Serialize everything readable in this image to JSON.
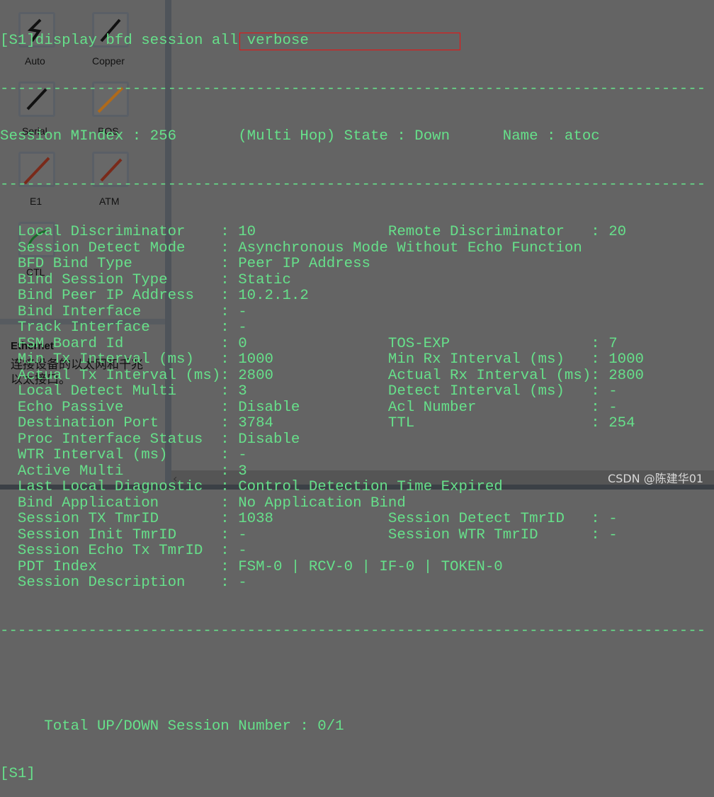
{
  "background_panel": {
    "tiles": [
      {
        "label": "Auto",
        "icon": "lightning-icon"
      },
      {
        "label": "Copper",
        "icon": "copper-cable-icon"
      },
      {
        "label": "Serial",
        "icon": "serial-cable-icon"
      },
      {
        "label": "POS",
        "icon": "pos-cable-icon"
      },
      {
        "label": "E1",
        "icon": "e1-cable-icon"
      },
      {
        "label": "ATM",
        "icon": "atm-cable-icon"
      },
      {
        "label": "CTL",
        "icon": "ctl-cable-icon"
      }
    ],
    "tooltip_title": "Ethernet",
    "tooltip_text": "连接设备的以太网和千兆以太接口。"
  },
  "terminal": {
    "command": "[S1]display bfd session all verbose",
    "separator": "--------------------------------------------------------------------------------",
    "mindex_label": "Session MIndex : 256",
    "state": "(Multi Hop) State : Down",
    "name": "Name : atoc",
    "rows": [
      {
        "l": "Local Discriminator",
        "lv": "10",
        "r": "Remote Discriminator",
        "rv": "20"
      },
      {
        "l": "Session Detect Mode",
        "lv": "Asynchronous Mode Without Echo Function"
      },
      {
        "l": "BFD Bind Type",
        "lv": "Peer IP Address"
      },
      {
        "l": "Bind Session Type",
        "lv": "Static"
      },
      {
        "l": "Bind Peer IP Address",
        "lv": "10.2.1.2"
      },
      {
        "l": "Bind Interface",
        "lv": "-"
      },
      {
        "l": "Track Interface",
        "lv": "-"
      },
      {
        "l": "FSM Board Id",
        "lv": "0",
        "r": "TOS-EXP",
        "rv": "7"
      },
      {
        "l": "Min Tx Interval (ms)",
        "lv": "1000",
        "r": "Min Rx Interval (ms)",
        "rv": "1000"
      },
      {
        "l": "Actual Tx Interval (ms)",
        "lv": "2800",
        "r": "Actual Rx Interval (ms)",
        "rv": "2800"
      },
      {
        "l": "Local Detect Multi",
        "lv": "3",
        "r": "Detect Interval (ms)",
        "rv": "-"
      },
      {
        "l": "Echo Passive",
        "lv": "Disable",
        "r": "Acl Number",
        "rv": "-"
      },
      {
        "l": "Destination Port",
        "lv": "3784",
        "r": "TTL",
        "rv": "254"
      },
      {
        "l": "Proc Interface Status",
        "lv": "Disable"
      },
      {
        "l": "WTR Interval (ms)",
        "lv": "-"
      },
      {
        "l": "Active Multi",
        "lv": "3"
      },
      {
        "l": "Last Local Diagnostic",
        "lv": "Control Detection Time Expired"
      },
      {
        "l": "Bind Application",
        "lv": "No Application Bind"
      },
      {
        "l": "Session TX TmrID",
        "lv": "1038",
        "r": "Session Detect TmrID",
        "rv": "-"
      },
      {
        "l": "Session Init TmrID",
        "lv": "-",
        "r": "Session WTR TmrID",
        "rv": "-"
      },
      {
        "l": "Session Echo Tx TmrID",
        "lv": "-"
      },
      {
        "l": "PDT Index",
        "lv": "FSM-0 | RCV-0 | IF-0 | TOKEN-0"
      },
      {
        "l": "Session Description",
        "lv": "-"
      }
    ],
    "total": "Total UP/DOWN Session Number : 0/1",
    "prompt": "[S1]"
  },
  "watermark": "CSDN @陈建华01",
  "colors": {
    "terminal_text": "#66e08a",
    "background": "#646464",
    "highlight_box": "#e11111"
  }
}
